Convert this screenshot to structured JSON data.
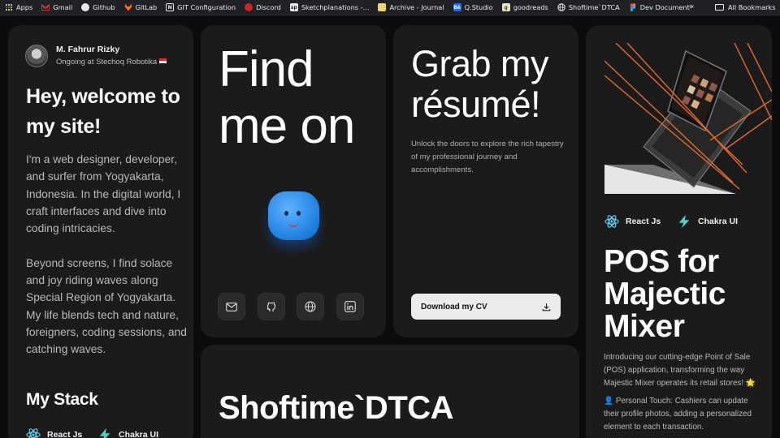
{
  "bookmarks": {
    "items": [
      {
        "label": "Apps",
        "icon": "apps-grid-icon",
        "color": "#e8eaed"
      },
      {
        "label": "Gmail",
        "icon": "gmail-icon",
        "color": "#ea4335"
      },
      {
        "label": "Github",
        "icon": "github-icon",
        "color": "#e8eaed"
      },
      {
        "label": "GitLab",
        "icon": "gitlab-icon",
        "color": "#fc6d26"
      },
      {
        "label": "GIT Configuration",
        "icon": "notion-icon",
        "color": "#e8eaed"
      },
      {
        "label": "Discord",
        "icon": "discord-icon",
        "color": "#c62828"
      },
      {
        "label": "Sketchplanations -...",
        "icon": "sketchplanations-icon",
        "color": "#e8eaed"
      },
      {
        "label": "Archive - Journal",
        "icon": "archive-icon",
        "color": "#f5d36b"
      },
      {
        "label": "Q.Studio",
        "icon": "behance-icon",
        "color": "#1769ff"
      },
      {
        "label": "goodreads",
        "icon": "goodreads-icon",
        "color": "#e9e5cd"
      },
      {
        "label": "Shoftime`DTCA",
        "icon": "globe-icon",
        "color": "#e8eaed"
      },
      {
        "label": "Dev Document",
        "icon": "figma-icon",
        "color": "#f24e1e"
      }
    ],
    "more": "»",
    "all_bookmarks": "All Bookmarks"
  },
  "profile": {
    "name": "M. Fahrur Rizky",
    "status": "Ongoing at Stechoq Robotika",
    "welcome": "Hey, welcome to my site!",
    "bio_1": "I'm a web designer, developer, and surfer from Yogyakarta, Indonesia. In the digital world, I craft interfaces and dive into coding intricacies.",
    "bio_2": "Beyond screens, I find solace and joy riding waves along Special Region of Yogyakarta. My life blends tech and nature, foreigners, coding sessions, and catching waves.",
    "stack_title": "My Stack",
    "stack": [
      "React Js",
      "Chakra UI"
    ]
  },
  "find": {
    "title": "Find me on",
    "socials": [
      "mail-icon",
      "github-icon",
      "globe-icon",
      "linkedin-icon"
    ]
  },
  "resume": {
    "title": "Grab my résumé!",
    "description": "Unlock the doors to explore the rich tapestry of my professional journey and accomplishments.",
    "button": "Download my CV"
  },
  "project": {
    "stack": [
      "React Js",
      "Chakra UI"
    ],
    "title": "POS for Majectic Mixer",
    "description": "Introducing our cutting-edge Point of Sale (POS) application, transforming the way Majestic Mixer operates its retail stores! 🌟",
    "feature": "👤 Personal Touch: Cashiers can update their profile photos, adding a personalized element to each transaction."
  },
  "shoftime": {
    "title": "Shoftime`DTCA"
  }
}
